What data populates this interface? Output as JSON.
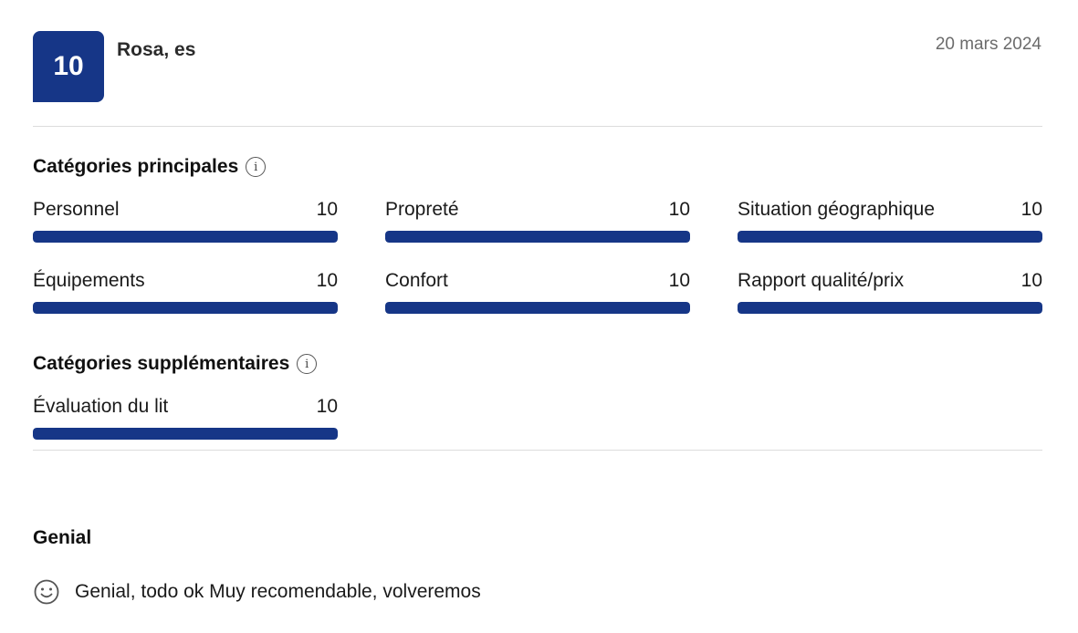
{
  "review": {
    "score": "10",
    "reviewer": "Rosa, es",
    "date": "20 mars 2024",
    "title": "Genial",
    "comment": "Genial, todo ok Muy recomendable, volveremos"
  },
  "main_categories": {
    "heading": "Catégories principales",
    "items": [
      {
        "label": "Personnel",
        "score": "10",
        "fraction": 1.0
      },
      {
        "label": "Propreté",
        "score": "10",
        "fraction": 1.0
      },
      {
        "label": "Situation géographique",
        "score": "10",
        "fraction": 1.0
      },
      {
        "label": "Équipements",
        "score": "10",
        "fraction": 1.0
      },
      {
        "label": "Confort",
        "score": "10",
        "fraction": 1.0
      },
      {
        "label": "Rapport qualité/prix",
        "score": "10",
        "fraction": 1.0
      }
    ]
  },
  "extra_categories": {
    "heading": "Catégories supplémentaires",
    "items": [
      {
        "label": "Évaluation du lit",
        "score": "10",
        "fraction": 1.0
      }
    ]
  },
  "icons": {
    "info": "info-icon",
    "positive_comment": "smile-icon"
  },
  "colors": {
    "brand": "#163687"
  }
}
